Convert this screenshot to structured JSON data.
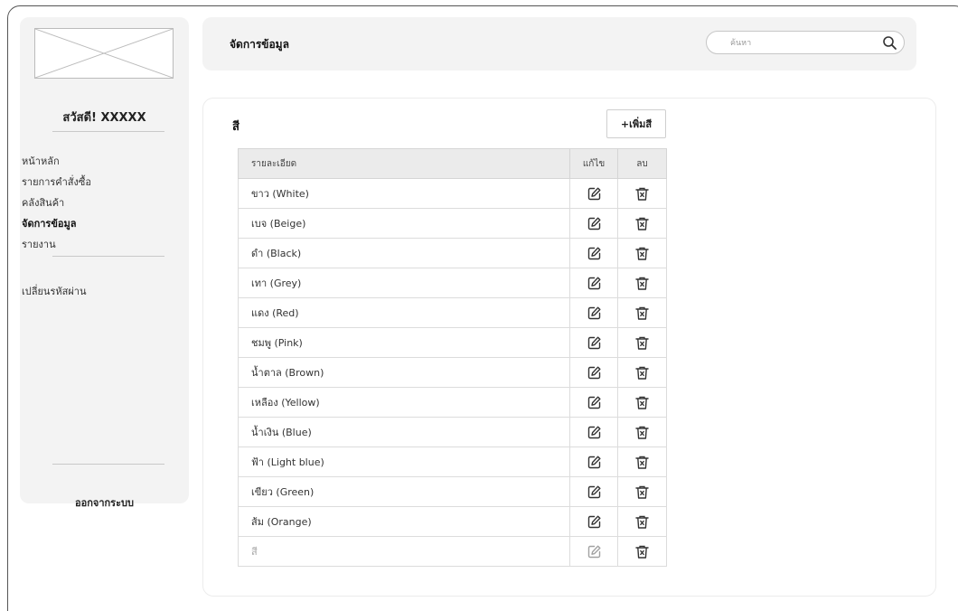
{
  "sidebar": {
    "greeting": "สวัสดี! XXXXX",
    "nav_items": [
      {
        "label": "หน้าหลัก",
        "active": false
      },
      {
        "label": "รายการคำสั่งซื้อ",
        "active": false
      },
      {
        "label": "คลังสินค้า",
        "active": false
      },
      {
        "label": "จัดการข้อมูล",
        "active": true
      },
      {
        "label": "รายงาน",
        "active": false
      }
    ],
    "change_password": "เปลี่ยนรหัสผ่าน",
    "logout": "ออกจากระบบ"
  },
  "header": {
    "title": "จัดการข้อมูล",
    "search_placeholder": "ค้นหา",
    "search_icon": "search-icon"
  },
  "main": {
    "section_title": "สี",
    "add_button": "+เพิ่มสี",
    "table": {
      "columns": [
        "รายละเอียด",
        "แก้ไข",
        "ลบ"
      ],
      "edit_icon": "edit-icon",
      "delete_icon": "trash-icon",
      "rows": [
        "ขาว (White)",
        "เบจ (Beige)",
        "ดำ (Black)",
        "เทา (Grey)",
        "แดง (Red)",
        "ชมพู (Pink)",
        "น้ำตาล (Brown)",
        "เหลือง (Yellow)",
        "น้ำเงิน (Blue)",
        "ฟ้า (Light blue)",
        "เขียว (Green)",
        "ส้ม (Orange)"
      ],
      "new_row_placeholder": "สี"
    }
  },
  "colors": {
    "panel_bg": "#f3f3f3",
    "header_row_bg": "#ebebeb",
    "border": "#dcdcdc"
  }
}
